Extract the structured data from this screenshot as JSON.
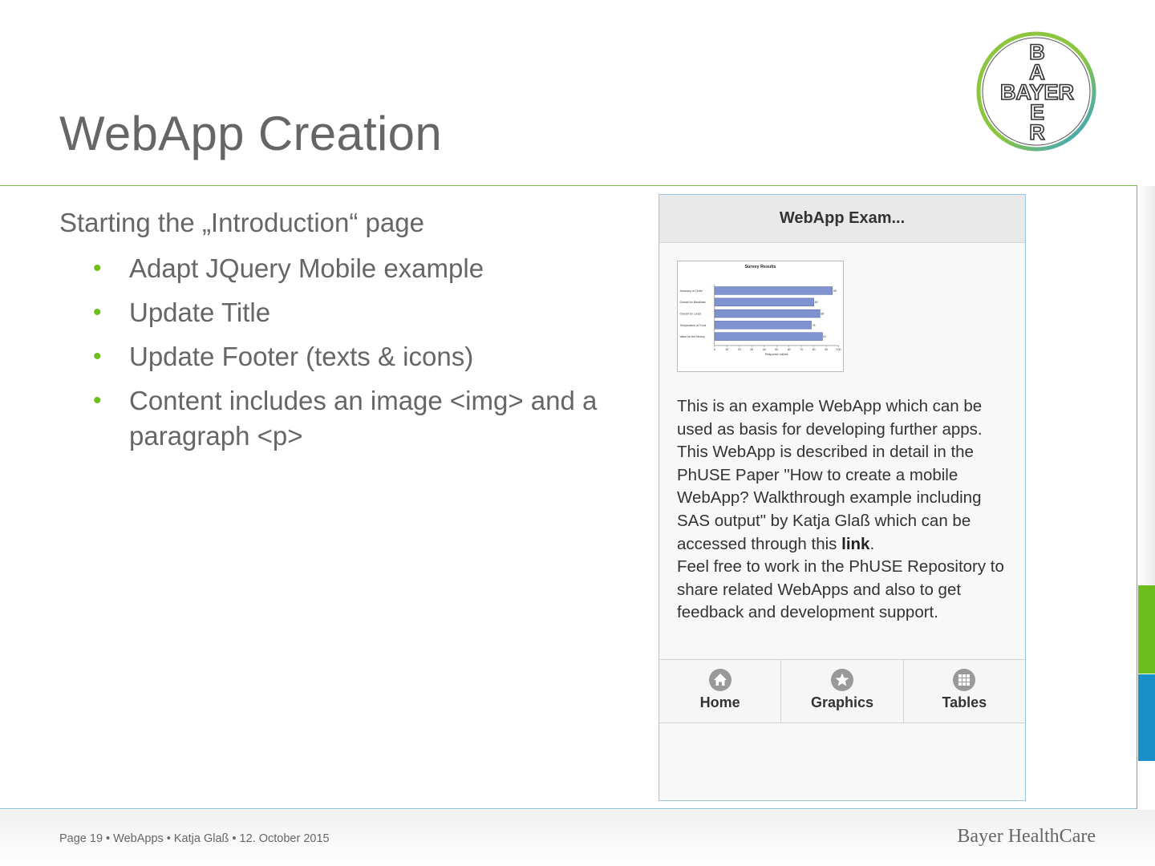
{
  "slide": {
    "title": "WebApp Creation",
    "intro": "Starting the „Introduction“ page",
    "bullets": [
      "Adapt JQuery Mobile example",
      "Update Title",
      "Update Footer (texts & icons)",
      "Content includes an image <img> and a paragraph <p>"
    ],
    "bullet_color": "#6dbd1f"
  },
  "logo": {
    "letters_vertical": [
      "B",
      "A",
      "Y",
      "E",
      "R"
    ],
    "letters_horizontal": "BAYER",
    "ring_colors": [
      "#8cc63f",
      "#2e9fd8"
    ]
  },
  "webapp": {
    "header_title": "WebApp Exam...",
    "chart": {
      "title": "Survey Results",
      "categories": [
        "Accuracy of Order",
        "Overall for Breakfast",
        "Overall for Lunch",
        "Temperature of Food",
        "Value for the Money"
      ],
      "values": [
        95,
        80,
        85,
        78,
        87
      ],
      "xlabel": "Response values",
      "ticks": [
        "0",
        "10",
        "20",
        "30",
        "40",
        "50",
        "60",
        "70",
        "80",
        "90",
        "100"
      ]
    },
    "paragraph_1": "This is an example WebApp which can be used as basis for developing further apps. This WebApp is described in detail in the PhUSE Paper \"How to create a mobile WebApp? Walkthrough example including SAS output\" by Katja Glaß which can be accessed through this ",
    "link_text": "link",
    "paragraph_1_end": ".",
    "paragraph_2": "Feel free to work in the PhUSE Repository to share related WebApps and also to get feedback and development support.",
    "footer_tabs": [
      {
        "label": "Home",
        "icon": "home-icon"
      },
      {
        "label": "Graphics",
        "icon": "star-icon"
      },
      {
        "label": "Tables",
        "icon": "grid-icon"
      }
    ]
  },
  "footer": {
    "left": "Page 19 • WebApps • Katja Glaß • 12. October 2015",
    "right": "Bayer HealthCare"
  },
  "colors": {
    "accent_green": "#6dbd1f",
    "accent_blue": "#1a8fc8",
    "text_gray": "#666666"
  }
}
